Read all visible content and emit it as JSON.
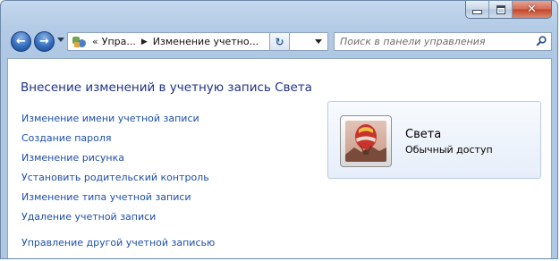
{
  "window": {
    "controls": {
      "minimize_icon": "minimize-icon",
      "maximize_icon": "maximize-icon",
      "close_icon": "close-icon",
      "close_glyph": "✕"
    }
  },
  "navigation": {
    "back_glyph": "←",
    "forward_glyph": "→",
    "address": {
      "icon": "control-panel-icon",
      "overflow": "«",
      "crumb_1": "Упра...",
      "separator": "▶",
      "crumb_2": "Изменение учетно..."
    },
    "refresh_glyph": "↻",
    "search": {
      "placeholder": "Поиск в панели управления"
    }
  },
  "page": {
    "title": "Внесение изменений в учетную запись Света",
    "tasks": [
      "Изменение имени учетной записи",
      "Создание пароля",
      "Изменение рисунка",
      "Установить родительский контроль",
      "Изменение типа учетной записи",
      "Удаление учетной записи"
    ],
    "other_account_link": "Управление другой учетной записью"
  },
  "account": {
    "avatar": "hot-air-balloon-picture",
    "name": "Света",
    "type": "Обычный доступ"
  },
  "colors": {
    "title": "#1e3287",
    "link": "#1e4fa8",
    "chrome": "#b4cbe6",
    "close_button": "#c4442a"
  }
}
